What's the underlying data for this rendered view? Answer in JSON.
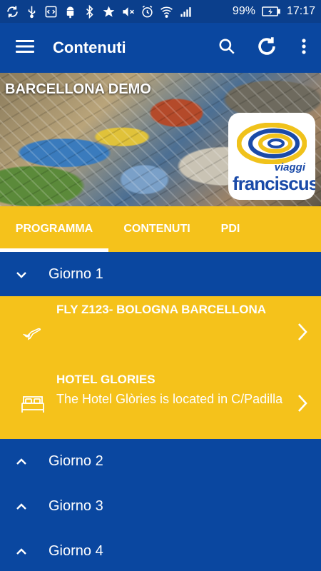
{
  "status_bar": {
    "battery_pct": "99%",
    "time": "17:17",
    "icons": [
      "sync-icon",
      "usb-icon",
      "code-icon",
      "android-icon",
      "bluetooth-icon",
      "star-icon",
      "mute-icon",
      "alarm-icon",
      "wifi-icon",
      "signal-icon",
      "battery-icon"
    ]
  },
  "app_bar": {
    "title": "Contenuti",
    "icons": [
      "menu-icon",
      "search-icon",
      "refresh-icon",
      "more-vert-icon"
    ]
  },
  "hero": {
    "title": "BARCELLONA DEMO",
    "logo_small": "viaggi",
    "logo_brand": "franciscus"
  },
  "tabs": [
    {
      "label": "PROGRAMMA",
      "selected": true
    },
    {
      "label": "CONTENUTI",
      "selected": false
    },
    {
      "label": "PDI",
      "selected": false
    }
  ],
  "days": [
    {
      "label": "Giorno 1",
      "expanded": true,
      "items": [
        {
          "icon": "airplane-icon",
          "title": "FLY Z123-  BOLOGNA BARCELLONA",
          "subtitle": ""
        },
        {
          "icon": "bed-icon",
          "title": "HOTEL GLORIES",
          "subtitle": "The Hotel Glòries is located in C/Padilla"
        }
      ]
    },
    {
      "label": "Giorno 2",
      "expanded": false
    },
    {
      "label": "Giorno 3",
      "expanded": false
    },
    {
      "label": "Giorno 4",
      "expanded": false
    }
  ],
  "colors": {
    "primary_blue": "#0a47a0",
    "status_blue": "#0b3f8c",
    "accent_yellow": "#f5c21b",
    "logo_blue": "#1a4aa8"
  }
}
